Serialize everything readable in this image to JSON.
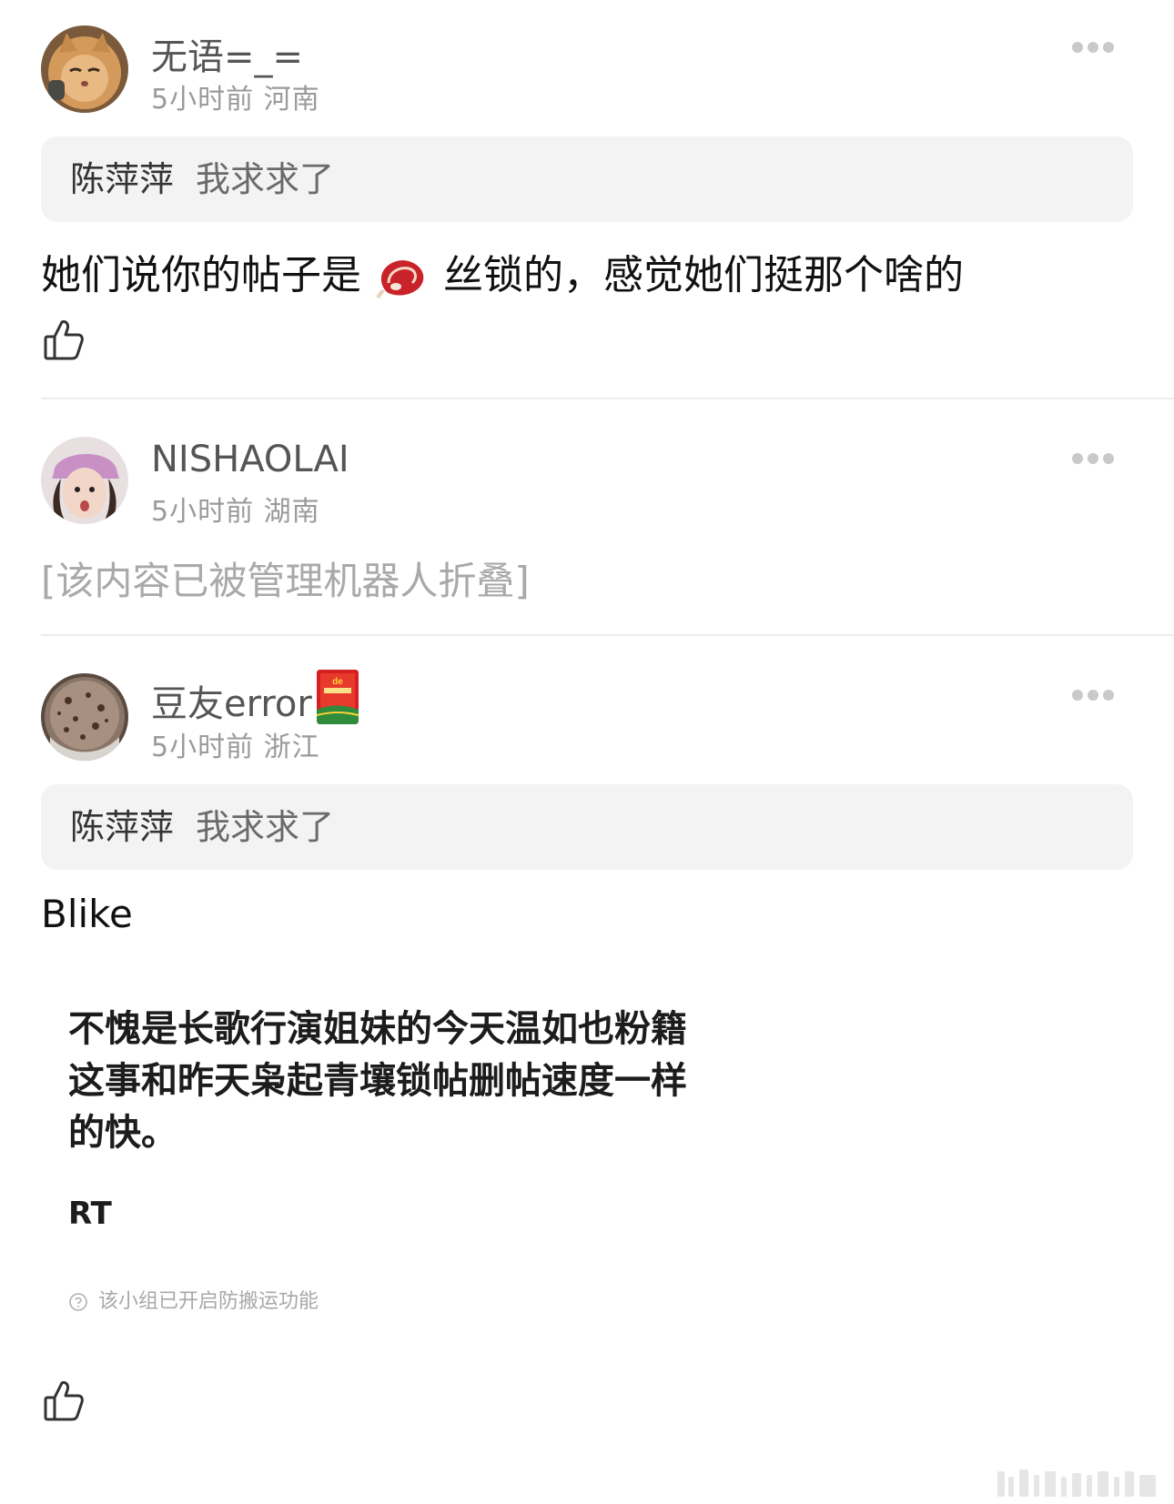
{
  "comments": [
    {
      "username": "无语=_=",
      "meta": "5小时前 河南",
      "quote": {
        "name": "陈萍萍",
        "text": "我求求了"
      },
      "text_before": "她们说你的帖子是",
      "emoji_icon": "meat-steak-icon",
      "text_after": "丝锁的，感觉她们挺那个啥的"
    },
    {
      "username": "NISHAOLAI",
      "meta": "5小时前 湖南",
      "folded_text": "[该内容已被管理机器人折叠]"
    },
    {
      "username": "豆友error",
      "badge_icon": "red-book-badge-icon",
      "meta": "5小时前 浙江",
      "quote": {
        "name": "陈萍萍",
        "text": "我求求了"
      },
      "text": "Blike",
      "embed": {
        "lines": [
          "不愧是长歌行演姐妹的今天温如也粉籍",
          "这事和昨天枭起青壤锁帖删帖速度一样",
          "的快。"
        ],
        "rt": "RT",
        "note": "该小组已开启防搬运功能"
      }
    }
  ],
  "icons": [
    "thumbs-up-icon",
    "more-dots-icon",
    "question-circle-icon"
  ]
}
